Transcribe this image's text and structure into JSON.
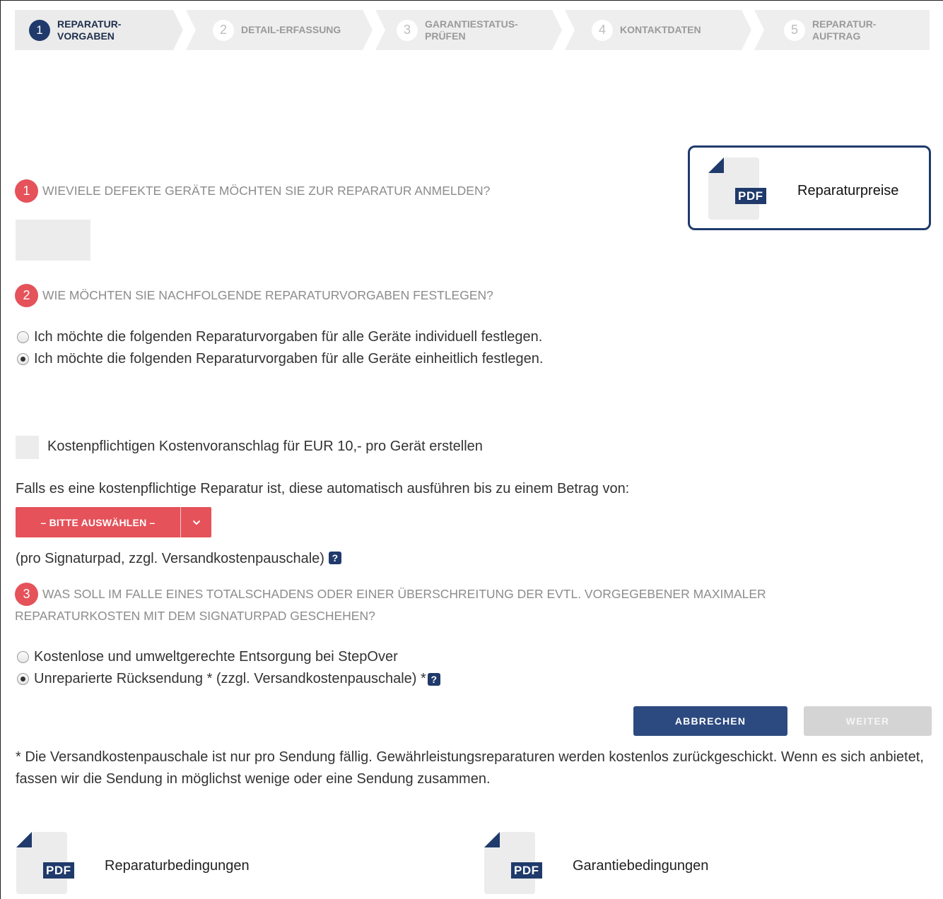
{
  "stepper": {
    "steps": [
      {
        "number": "1",
        "label": "Reparatur-\nVorgaben",
        "active": true
      },
      {
        "number": "2",
        "label": "Detail-Erfassung",
        "active": false
      },
      {
        "number": "3",
        "label": "Garantiestatus-\nprüfen",
        "active": false
      },
      {
        "number": "4",
        "label": "Kontaktdaten",
        "active": false
      },
      {
        "number": "5",
        "label": "Reparatur-\nauftrag",
        "active": false
      }
    ]
  },
  "price_card": {
    "pdf_tag": "PDF",
    "label": "Reparaturpreise"
  },
  "question1": {
    "number": "1",
    "text": "Wieviele defekte Geräte möchten Sie zur Reparatur anmelden?",
    "input_value": ""
  },
  "question2": {
    "number": "2",
    "text": "Wie möchten Sie nachfolgende Reparaturvorgaben festlegen?",
    "options": [
      {
        "label": "Ich möchte die folgenden Reparaturvorgaben für alle Geräte individuell festlegen.",
        "checked": false
      },
      {
        "label": "Ich möchte die folgenden Reparaturvorgaben für alle Geräte einheitlich festlegen.",
        "checked": true
      }
    ]
  },
  "estimate": {
    "checkbox_label": "Kostenpflichtigen Kostenvoranschlag für EUR 10,- pro Gerät erstellen",
    "checked": false
  },
  "auto_repair": {
    "text": "Falls es eine kostenpflichtige Reparatur ist, diese automatisch ausführen bis zu einem Betrag von:",
    "select_label": "– BITTE AUSWÄHLEN –",
    "note": "(pro Signaturpad, zzgl. Versandkostenpauschale)",
    "help": "?"
  },
  "question3": {
    "number": "3",
    "line1": "Was soll im Falle eines Totalschadens oder einer Überschreitung der evtl. vorgegebener maximaler",
    "line2": "Reparaturkosten mit dem Signaturpad geschehen?",
    "options": [
      {
        "label": "Kostenlose und umweltgerechte Entsorgung bei StepOver",
        "checked": false
      },
      {
        "label": "Unreparierte Rücksendung * (zzgl. Versandkostenpauschale) *",
        "checked": true
      }
    ],
    "help": "?"
  },
  "buttons": {
    "cancel": "ABBRECHEN",
    "next": "WEITER"
  },
  "footnote": "* Die Versandkostenpauschale ist nur pro Sendung fällig. Gewährleistungsreparaturen werden kostenlos zurückgeschickt. Wenn es sich anbietet, fassen wir die Sendung in möglichst wenige oder eine Sendung zusammen.",
  "documents": [
    {
      "pdf_tag": "PDF",
      "label": "Reparaturbedingungen"
    },
    {
      "pdf_tag": "PDF",
      "label": "Garantiebedingungen"
    }
  ],
  "colors": {
    "navy": "#1f3a6b",
    "accent_red": "#e5525a",
    "disabled_gray": "#d4d4d4"
  }
}
